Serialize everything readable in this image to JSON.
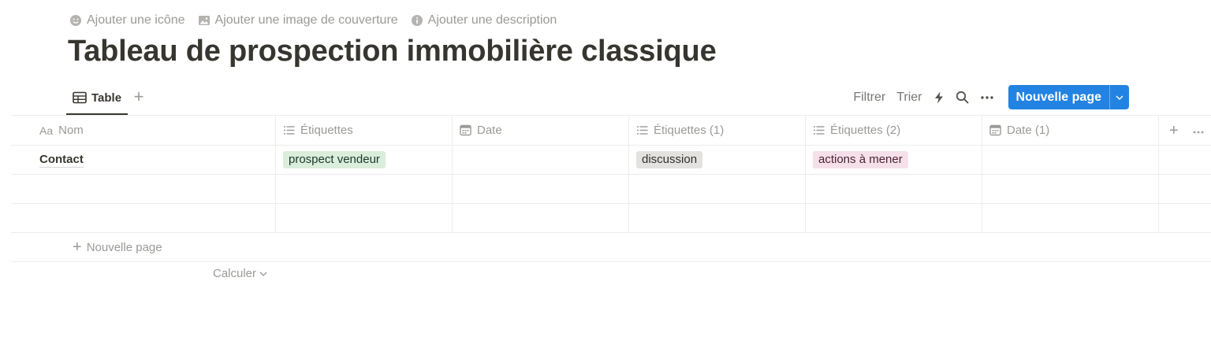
{
  "page_meta": {
    "add_icon": "Ajouter une icône",
    "add_cover": "Ajouter une image de couverture",
    "add_description": "Ajouter une description"
  },
  "title": "Tableau de prospection immobilière classique",
  "view": {
    "tab_label": "Table",
    "actions": {
      "filter": "Filtrer",
      "sort": "Trier",
      "new_page": "Nouvelle page"
    }
  },
  "columns": [
    {
      "label": "Nom",
      "type_marker": "Aa",
      "icon": "title-icon"
    },
    {
      "label": "Étiquettes",
      "icon": "list-icon"
    },
    {
      "label": "Date",
      "icon": "calendar-icon"
    },
    {
      "label": "Étiquettes (1)",
      "icon": "list-icon"
    },
    {
      "label": "Étiquettes (2)",
      "icon": "list-icon"
    },
    {
      "label": "Date (1)",
      "icon": "calendar-icon"
    }
  ],
  "rows": [
    {
      "name": "Contact",
      "tags": {
        "label": "prospect vendeur",
        "bg": "#dbeddb",
        "fg": "#1c3829"
      },
      "tags1": {
        "label": "discussion",
        "bg": "#e3e2e0",
        "fg": "#32302c"
      },
      "tags2": {
        "label": "actions à mener",
        "bg": "#f5e0e9",
        "fg": "#4c2337"
      }
    }
  ],
  "new_row_label": "Nouvelle page",
  "calculate_label": "Calculer",
  "colors": {
    "accent": "#2383e2",
    "text": "#37352f",
    "muted": "#9b9a97",
    "border": "#ededec"
  }
}
